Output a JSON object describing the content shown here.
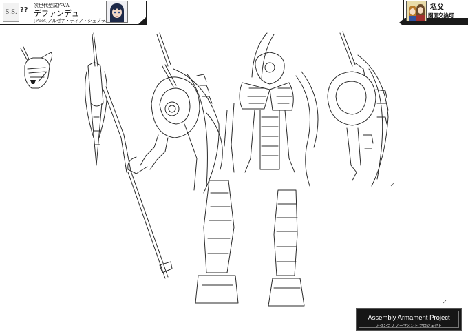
{
  "header": {
    "ss_label": "S.S.",
    "unknown_mark": "??",
    "series": "次世代型試作VA",
    "unit_name": "デファンデュ",
    "pilot": "[Pilot]アルゼナ・ディア・シュブラム"
  },
  "author": {
    "name": "私父",
    "note": "図面交換可"
  },
  "footer": {
    "project_title": "Assembly Armament Project",
    "project_subtitle": "アセンブリ アーマメント プロジェクト"
  },
  "colors": {
    "background": "#ffffff",
    "header_rule": "#1a1a1a",
    "footer_box": "#161616",
    "author_icon_bg": "#e9dcaa"
  },
  "icons": [
    "pilot-portrait",
    "author-icon"
  ]
}
